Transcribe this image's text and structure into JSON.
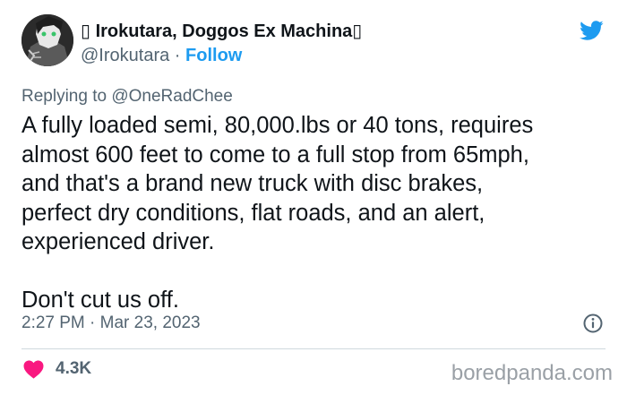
{
  "author": {
    "display_name": "▯ Irokutara, Doggos Ex Machina▯",
    "handle": "@Irokutara",
    "separator": "·",
    "follow_label": "Follow"
  },
  "reply": {
    "prefix": "Replying to",
    "target": "@OneRadChee"
  },
  "tweet": {
    "paragraphs": [
      "A fully loaded semi, 80,000.lbs or 40 tons, requires\nalmost 600 feet to come to a full stop from 65mph,\nand that's a brand new truck with disc brakes,\nperfect dry conditions, flat roads, and an alert,\nexperienced driver.",
      "Don't cut us off."
    ],
    "timestamp": "2:27 PM · Mar 23, 2023"
  },
  "footer": {
    "likes": "4.3K",
    "watermark": "boredpanda.com"
  },
  "icons": {
    "platform": "twitter-bird-icon",
    "info": "info-icon",
    "like": "heart-icon"
  },
  "colors": {
    "accent": "#1d9bf0",
    "heart": "#f91880",
    "secondary_text": "#536471",
    "primary_text": "#0f1419",
    "divider": "#cfd9de"
  }
}
